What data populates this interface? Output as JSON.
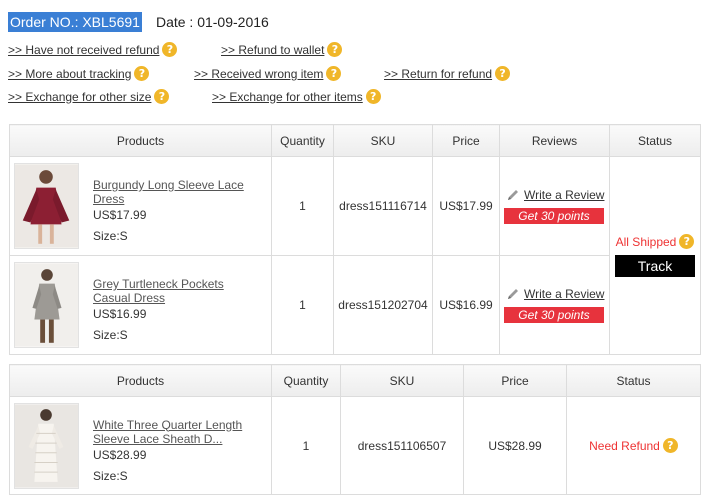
{
  "order": {
    "number": "Order NO.: XBL5691",
    "date": "Date : 01-09-2016"
  },
  "help_links": [
    {
      "label": ">> Have not received refund"
    },
    {
      "label": ">> Refund to wallet"
    },
    {
      "label": ">> More about tracking"
    },
    {
      "label": ">> Received wrong item"
    },
    {
      "label": ">> Return for refund"
    },
    {
      "label": ">> Exchange for other size"
    },
    {
      "label": ">> Exchange for other items"
    }
  ],
  "question_glyph": "?",
  "shipped_table": {
    "headers": {
      "products": "Products",
      "quantity": "Quantity",
      "sku": "SKU",
      "price": "Price",
      "reviews": "Reviews",
      "status": "Status"
    },
    "rows": [
      {
        "name": "Burgundy Long Sleeve Lace Dress",
        "price": "US$17.99",
        "size": "Size:S",
        "quantity": "1",
        "sku": "dress151116714",
        "unit_price": "US$17.99",
        "review_label": "Write a Review",
        "points_label": "Get 30 points"
      },
      {
        "name": "Grey Turtleneck Pockets Casual Dress",
        "price": "US$16.99",
        "size": "Size:S",
        "quantity": "1",
        "sku": "dress151202704",
        "unit_price": "US$16.99",
        "review_label": "Write a Review",
        "points_label": "Get 30 points"
      }
    ],
    "status": "All Shipped",
    "track_label": "Track"
  },
  "refund_table": {
    "headers": {
      "products": "Products",
      "quantity": "Quantity",
      "sku": "SKU",
      "price": "Price",
      "status": "Status"
    },
    "rows": [
      {
        "name": "White Three Quarter Length Sleeve Lace Sheath D...",
        "price": "US$28.99",
        "size": "Size:S",
        "quantity": "1",
        "sku": "dress151106507",
        "unit_price": "US$28.99",
        "status": "Need Refund"
      }
    ]
  },
  "colors": {
    "order_highlight": "#3a7fd5",
    "help_icon": "#f0b629",
    "points_button": "#e7333d",
    "status_red": "#e33333",
    "track_button": "#000000"
  },
  "icons": {
    "help": "question-circle-icon",
    "review": "pencil-icon"
  }
}
